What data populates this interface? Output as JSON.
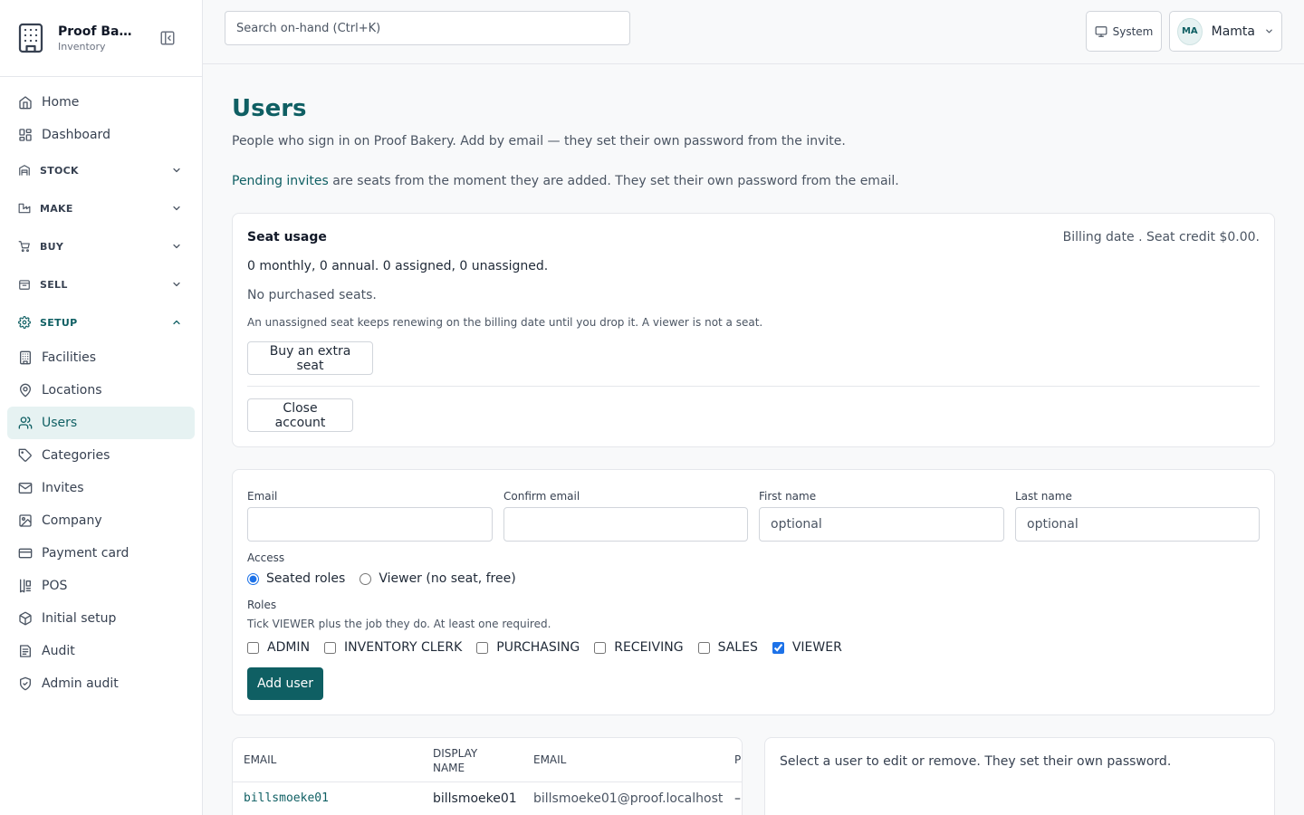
{
  "brand": {
    "name": "Proof Bakery",
    "subtitle": "Inventory"
  },
  "sidebar": {
    "top_items": [
      {
        "label": "Home",
        "icon": "home-icon"
      },
      {
        "label": "Dashboard",
        "icon": "dashboard-icon"
      }
    ],
    "sections": [
      {
        "label": "STOCK",
        "open": false
      },
      {
        "label": "MAKE",
        "open": false
      },
      {
        "label": "BUY",
        "open": false
      },
      {
        "label": "SELL",
        "open": false
      },
      {
        "label": "SETUP",
        "open": true
      }
    ],
    "setup_items": [
      {
        "label": "Facilities",
        "icon": "building-icon"
      },
      {
        "label": "Locations",
        "icon": "map-pin-icon"
      },
      {
        "label": "Users",
        "icon": "users-icon",
        "active": true
      },
      {
        "label": "Categories",
        "icon": "tag-icon"
      },
      {
        "label": "Invites",
        "icon": "mail-icon"
      },
      {
        "label": "Company",
        "icon": "image-icon"
      },
      {
        "label": "Payment card",
        "icon": "credit-card-icon"
      },
      {
        "label": "POS",
        "icon": "pos-icon"
      },
      {
        "label": "Initial setup",
        "icon": "package-icon"
      },
      {
        "label": "Audit",
        "icon": "audit-icon"
      },
      {
        "label": "Admin audit",
        "icon": "shield-check-icon"
      }
    ]
  },
  "topbar": {
    "search_placeholder": "Search on-hand (Ctrl+K)",
    "theme_label": "System",
    "user_initials": "MA",
    "user_name": "Mamta"
  },
  "page": {
    "title": "Users",
    "description": "People who sign in on Proof Bakery. Add by email — they set their own password from the invite.",
    "note_link": "Pending invites",
    "note_rest": " are seats from the moment they are added. They set their own password from the email."
  },
  "seat_usage": {
    "title": "Seat usage",
    "billing": "Billing date . Seat credit $0.00.",
    "counts": "0 monthly, 0 annual. 0 assigned, 0 unassigned.",
    "none": "No purchased seats.",
    "hint": "An unassigned seat keeps renewing on the billing date until you drop it. A viewer is not a seat.",
    "buy_label": "Buy an extra seat",
    "close_label": "Close account"
  },
  "form": {
    "email_label": "Email",
    "confirm_email_label": "Confirm email",
    "first_name_label": "First name",
    "first_name_placeholder": "optional",
    "last_name_label": "Last name",
    "last_name_placeholder": "optional",
    "access_label": "Access",
    "access_options": [
      {
        "label": "Seated roles",
        "checked": true
      },
      {
        "label": "Viewer (no seat, free)",
        "checked": false
      }
    ],
    "roles_label": "Roles",
    "roles_hint": "Tick VIEWER plus the job they do. At least one required.",
    "roles": [
      {
        "label": "ADMIN",
        "checked": false
      },
      {
        "label": "INVENTORY CLERK",
        "checked": false
      },
      {
        "label": "PURCHASING",
        "checked": false
      },
      {
        "label": "RECEIVING",
        "checked": false
      },
      {
        "label": "SALES",
        "checked": false
      },
      {
        "label": "VIEWER",
        "checked": true
      }
    ],
    "submit_label": "Add user"
  },
  "users_table": {
    "columns": [
      "EMAIL",
      "DISPLAY NAME",
      "EMAIL",
      "P"
    ],
    "rows": [
      {
        "username": "billsmoeke01",
        "display_name": "billsmoeke01",
        "email": "billsmoeke01@proof.localhost",
        "extra": "–"
      }
    ]
  },
  "detail": {
    "text": "Select a user to edit or remove. They set their own password."
  }
}
